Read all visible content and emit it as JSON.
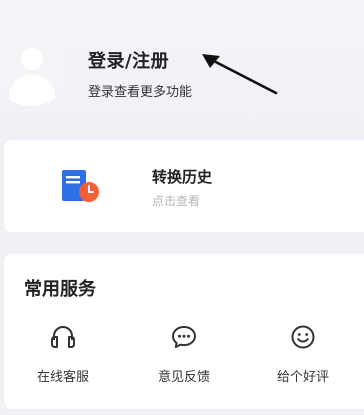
{
  "user": {
    "title": "登录/注册",
    "subtitle": "登录查看更多功能"
  },
  "history": {
    "title": "转换历史",
    "subtitle": "点击查看",
    "icon": "document-clock-icon"
  },
  "services": {
    "title": "常用服务",
    "items": [
      {
        "label": "在线客服",
        "icon": "headset-icon"
      },
      {
        "label": "意见反馈",
        "icon": "chat-bubble-icon"
      },
      {
        "label": "给个好评",
        "icon": "smiley-icon"
      }
    ]
  },
  "colors": {
    "background": "#f0f1f6",
    "card": "#ffffff",
    "doc_blue": "#2f6fe4",
    "clock_orange": "#f2603b",
    "muted_text": "#b3b6bd"
  }
}
